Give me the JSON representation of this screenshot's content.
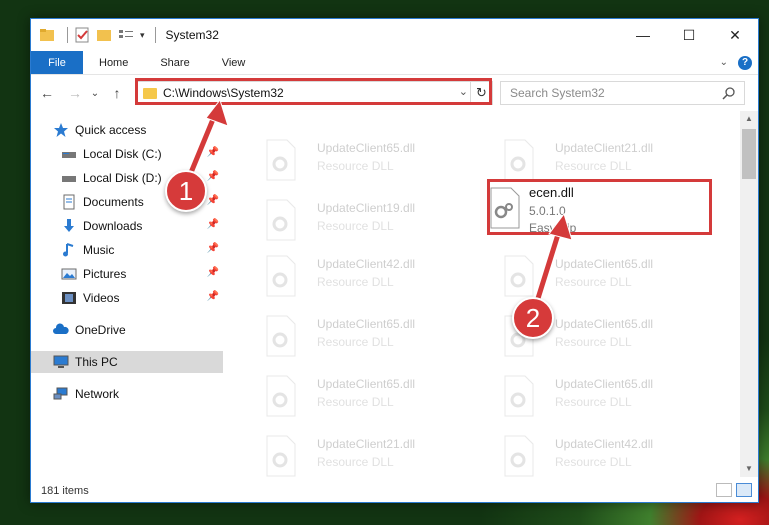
{
  "window": {
    "title": "System32",
    "controls": {
      "minimize": "—",
      "maximize": "☐",
      "close": "✕"
    }
  },
  "ribbon": {
    "tabs": [
      "File",
      "Home",
      "Share",
      "View"
    ],
    "help": "?"
  },
  "nav": {
    "back": "←",
    "forward": "→",
    "recent": "⌄",
    "up": "↑"
  },
  "address": {
    "path": "C:\\Windows\\System32",
    "dropdown": "⌄",
    "refresh": "↻"
  },
  "search": {
    "placeholder": "Search System32"
  },
  "sidebar": {
    "items": [
      {
        "label": "Quick access",
        "icon": "star-icon",
        "pinned": false
      },
      {
        "label": "Local Disk (C:)",
        "icon": "drive-icon",
        "pinned": true
      },
      {
        "label": "Local Disk (D:)",
        "icon": "drive-icon",
        "pinned": true
      },
      {
        "label": "Documents",
        "icon": "documents-icon",
        "pinned": true
      },
      {
        "label": "Downloads",
        "icon": "download-icon",
        "pinned": true
      },
      {
        "label": "Music",
        "icon": "music-icon",
        "pinned": true
      },
      {
        "label": "Pictures",
        "icon": "pictures-icon",
        "pinned": true
      },
      {
        "label": "Videos",
        "icon": "videos-icon",
        "pinned": true
      },
      {
        "label": "OneDrive",
        "icon": "cloud-icon",
        "pinned": false
      },
      {
        "label": "This PC",
        "icon": "pc-icon",
        "pinned": false,
        "selected": true
      },
      {
        "label": "Network",
        "icon": "network-icon",
        "pinned": false
      }
    ]
  },
  "files": {
    "left": [
      {
        "name": "UpdateClient65.dll",
        "type": "Resource DLL"
      },
      {
        "name": "UpdateClient19.dll",
        "type": "Resource DLL"
      },
      {
        "name": "UpdateClient42.dll",
        "type": "Resource DLL"
      },
      {
        "name": "UpdateClient65.dll",
        "type": "Resource DLL"
      },
      {
        "name": "UpdateClient65.dll",
        "type": "Resource DLL"
      },
      {
        "name": "UpdateClient21.dll",
        "type": "Resource DLL"
      }
    ],
    "right": [
      {
        "name": "UpdateClient21.dll",
        "type": "Resource DLL"
      },
      {
        "name": "UpdateClient65.dll",
        "type": "Resource DLL"
      },
      {
        "name": "UpdateClient65.dll",
        "type": "Resource DLL"
      },
      {
        "name": "UpdateClient65.dll",
        "type": "Resource DLL"
      },
      {
        "name": "UpdateClient42.dll",
        "type": "Resource DLL"
      }
    ],
    "highlighted": {
      "name": "ecen.dll",
      "version": "5.0.1.0",
      "company": "EasyClip"
    }
  },
  "status": {
    "count": "181 items"
  },
  "callouts": {
    "step1": "1",
    "step2": "2",
    "color": "#d43a3a"
  }
}
